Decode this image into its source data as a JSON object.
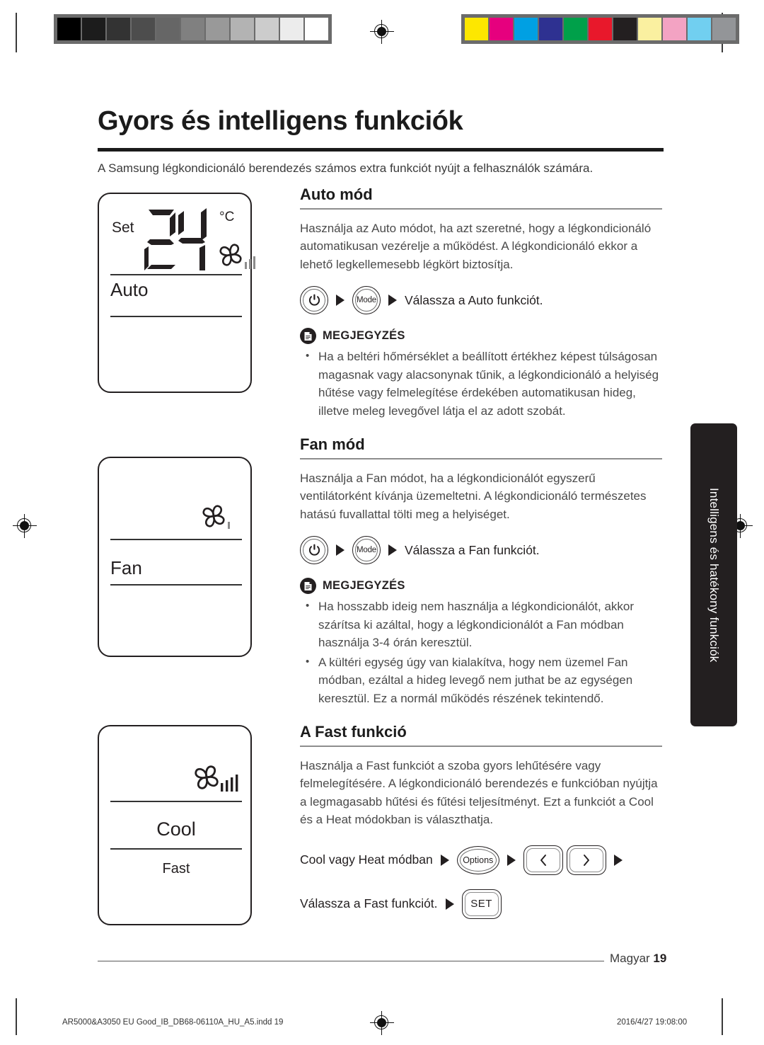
{
  "document": {
    "title": "Gyors és intelligens funkciók",
    "intro": "A Samsung légkondicionáló berendezés számos extra funkciót nyújt a felhasználók számára.",
    "side_tab": "Intelligens és hatékony funkciók",
    "footer": {
      "language": "Magyar",
      "page_number": "19",
      "imprint_left": "AR5000&A3050 EU Good_IB_DB68-06110A_HU_A5.indd   19",
      "imprint_right": "2016/4/27   19:08:00"
    }
  },
  "prepress": {
    "gray_wedge": [
      "#000000",
      "#1c1c1c",
      "#333333",
      "#4d4d4d",
      "#666666",
      "#808080",
      "#999999",
      "#b3b3b3",
      "#cccccc",
      "#ececec",
      "#ffffff"
    ],
    "color_bar": [
      "#fde700",
      "#e6007e",
      "#00a0e3",
      "#2e3191",
      "#00a04a",
      "#e8182b",
      "#231f20",
      "#faf0a0",
      "#f3a3c3",
      "#71cff0",
      "#939598"
    ],
    "registration_icon": "registration-target-icon"
  },
  "panels": [
    {
      "name": "auto",
      "set_label": "Set",
      "temperature": "24",
      "unit": "°C",
      "mode": "Auto",
      "fan_icon": "fan-pinwheel-icon",
      "fan_bars": 3
    },
    {
      "name": "fan",
      "mode": "Fan",
      "fan_icon": "fan-pinwheel-icon",
      "fan_bars": 1
    },
    {
      "name": "cool",
      "mode": "Cool",
      "sub_mode": "Fast",
      "fan_icon": "fan-pinwheel-icon",
      "fan_bars": 4
    }
  ],
  "sections": [
    {
      "id": "auto",
      "heading": "Auto mód",
      "body": "Használja az Auto módot, ha azt szeretné, hogy a légkondicionáló automatikusan vezérelje a működést. A légkondicionáló ekkor a lehető legkellemesebb légkört biztosítja.",
      "step": {
        "power_icon": "power-icon",
        "mode_label": "Mode",
        "text": "Válassza a Auto funkciót."
      },
      "note": {
        "badge_icon": "note-document-icon",
        "title": "MEGJEGYZÉS",
        "items": [
          "Ha a beltéri hőmérséklet a beállított értékhez képest túlságosan magasnak vagy alacsonynak tűnik, a légkondicionáló a helyiség hűtése vagy felmelegítése érdekében automatikusan hideg, illetve meleg levegővel látja el az adott szobát."
        ]
      }
    },
    {
      "id": "fan",
      "heading": "Fan mód",
      "body": "Használja a Fan módot, ha a légkondicionálót egyszerű ventilátorként kívánja üzemeltetni. A légkondicionáló természetes hatású fuvallattal tölti meg a helyiséget.",
      "step": {
        "power_icon": "power-icon",
        "mode_label": "Mode",
        "text": "Válassza a Fan funkciót."
      },
      "note": {
        "badge_icon": "note-document-icon",
        "title": "MEGJEGYZÉS",
        "items": [
          "Ha hosszabb ideig nem használja a légkondicionálót, akkor szárítsa ki azáltal, hogy a légkondicionálót a Fan módban használja 3-4 órán keresztül.",
          "A kültéri egység úgy van kialakítva, hogy nem üzemel Fan módban, ezáltal a hideg levegő nem juthat be az egységen keresztül. Ez a normál működés részének tekintendő."
        ]
      }
    },
    {
      "id": "fast",
      "heading": "A Fast funkció",
      "body": "Használja a Fast funkciót a szoba gyors lehűtésére vagy felmelegítésére. A légkondicionáló berendezés e funkcióban nyújtja a legmagasabb hűtési és fűtési teljesítményt. Ezt a funkciót a Cool és a Heat módokban is választhatja.",
      "steps": [
        {
          "text": "Cool vagy Heat módban",
          "options_label": "Options",
          "left_icon": "chevron-left-icon",
          "right_icon": "chevron-right-icon"
        },
        {
          "text": "Válassza a Fast funkciót.",
          "set_label": "SET"
        }
      ]
    }
  ]
}
